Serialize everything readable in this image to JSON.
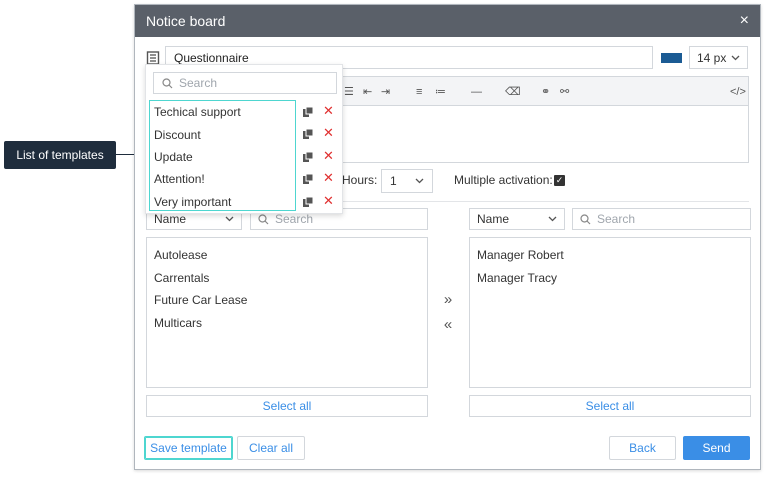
{
  "callout": {
    "text": "List of templates"
  },
  "dialog": {
    "title": "Notice board",
    "close_glyph": "×",
    "subject": {
      "value": "Questionnaire"
    },
    "text_color": "#1b5b94",
    "font_size": {
      "value": "14 px"
    },
    "hours": {
      "label": "Hours:",
      "value": "1"
    },
    "multiple_activation": {
      "label": "Multiple activation:",
      "checked": true
    },
    "left_panel": {
      "sort": "Name",
      "search_placeholder": "Search",
      "items": [
        "Autolease",
        "Carrentals",
        "Future Car Lease",
        "Multicars"
      ],
      "select_all": "Select all"
    },
    "right_panel": {
      "sort": "Name",
      "search_placeholder": "Search",
      "items": [
        "Manager Robert",
        "Manager Tracy"
      ],
      "select_all": "Select all"
    },
    "move_right": "»",
    "move_left": "«",
    "footer": {
      "save_template": "Save template",
      "clear_all": "Clear all",
      "back": "Back",
      "send": "Send"
    }
  },
  "templates": {
    "search_placeholder": "Search",
    "items": [
      "Techical support",
      "Discount",
      "Update",
      "Attention!",
      "Very important"
    ]
  },
  "colors": {
    "accent": "#3a8ee6",
    "highlight": "#4ed6d0",
    "titlebar": "#5a6069",
    "delete": "#e03030"
  }
}
